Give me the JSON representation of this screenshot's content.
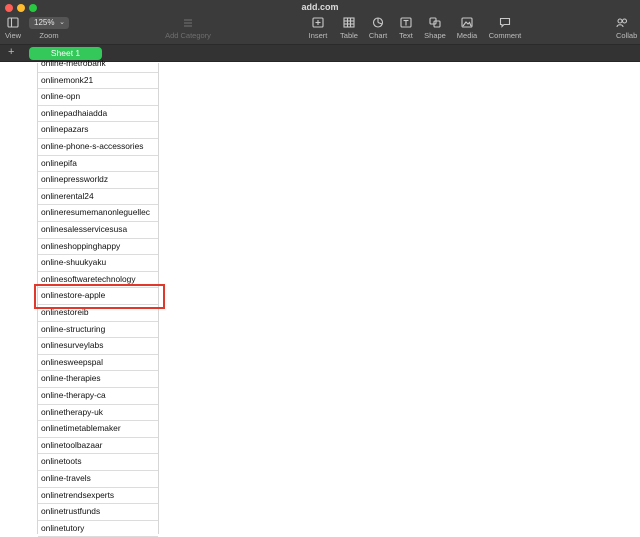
{
  "window": {
    "title": "add.com"
  },
  "toolbar": {
    "view_label": "View",
    "zoom_value": "125%",
    "zoom_label": "Zoom",
    "add_category_label": "Add Category",
    "insert_label": "Insert",
    "table_label": "Table",
    "chart_label": "Chart",
    "text_label": "Text",
    "shape_label": "Shape",
    "media_label": "Media",
    "comment_label": "Comment",
    "collab_label": "Collab"
  },
  "tabs": {
    "add_symbol": "+",
    "sheet_name": "Sheet 1"
  },
  "table": {
    "rows": [
      "online-metrobank",
      "onlinemonk21",
      "online-opn",
      "onlinepadhaiadda",
      "onlinepazars",
      "online-phone-s-accessories",
      "onlinepifa",
      "onlinepressworldz",
      "onlinerental24",
      "onlineresumemanonleguellec",
      "onlinesalesservicesusa",
      "onlineshoppinghappy",
      "online-shuukyaku",
      "onlinesoftwaretechnology",
      "onlinestore-apple",
      "onlinestoreib",
      "online-structuring",
      "onlinesurveylabs",
      "onlinesweepspal",
      "online-therapies",
      "online-therapy-ca",
      "onlinetherapy-uk",
      "onlinetimetablemaker",
      "onlinetoolbazaar",
      "onlinetoots",
      "online-travels",
      "onlinetrendsexperts",
      "onlinetrustfunds",
      "onlinetutory"
    ],
    "highlighted_row": "onlinestore-apple"
  },
  "colors": {
    "sheet_tab": "#34c759",
    "highlight": "#e0392b",
    "toolbar_bg": "#3b3b3b"
  }
}
